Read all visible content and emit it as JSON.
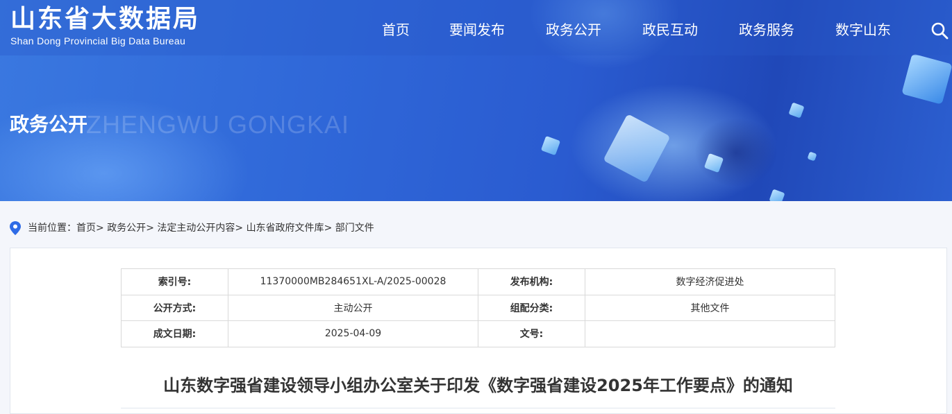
{
  "site": {
    "name_cn": "山东省大数据局",
    "name_en": "Shan Dong Provincial Big Data Bureau"
  },
  "nav": {
    "items": [
      {
        "label": "首页"
      },
      {
        "label": "要闻发布"
      },
      {
        "label": "政务公开"
      },
      {
        "label": "政民互动"
      },
      {
        "label": "政务服务"
      },
      {
        "label": "数字山东"
      }
    ],
    "search_icon": "search-icon"
  },
  "banner": {
    "title": "政务公开",
    "subtitle_watermark": "ZHENGWU GONGKAI"
  },
  "breadcrumb": {
    "prefix": "当前位置：",
    "items": [
      {
        "label": "首页"
      },
      {
        "label": "政务公开"
      },
      {
        "label": "法定主动公开内容"
      },
      {
        "label": "山东省政府文件库"
      },
      {
        "label": "部门文件"
      }
    ],
    "separator": ">"
  },
  "meta": {
    "index_label": "索引号:",
    "index_value": "11370000MB284651XL-A/2025-00028",
    "publisher_label": "发布机构:",
    "publisher_value": "数字经济促进处",
    "disclosure_label": "公开方式:",
    "disclosure_value": "主动公开",
    "category_label": "组配分类:",
    "category_value": "其他文件",
    "date_label": "成文日期:",
    "date_value": "2025-04-09",
    "docno_label": "文号:",
    "docno_value": ""
  },
  "document": {
    "title": "山东数字强省建设领导小组办公室关于印发《数字强省建设2025年工作要点》的通知"
  },
  "colors": {
    "banner_blue": "#2f67d8",
    "pin_blue": "#2e6be6",
    "card_bg": "#ffffff",
    "page_bg": "#f4f6fb"
  }
}
